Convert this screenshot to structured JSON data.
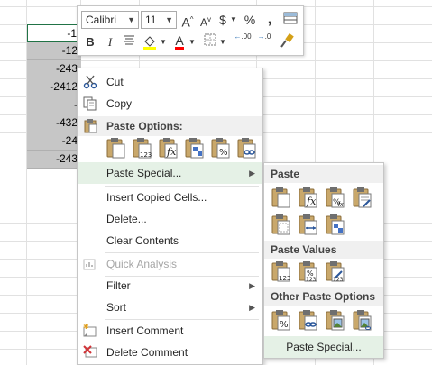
{
  "sheet": {
    "values": [
      "-1",
      "-12",
      "-243",
      "-2412",
      "-",
      "-432",
      "-24",
      "-243"
    ]
  },
  "mini_toolbar": {
    "font_name": "Calibri",
    "font_size": "11",
    "grow_font_label": "A",
    "shrink_font_label": "A",
    "currency_label": "$",
    "percent_label": "%",
    "bold_label": "B",
    "italic_label": "I",
    "font_color_label": "A",
    "increase_decimal_label": ".00",
    "decrease_decimal_label": ".0",
    "highlight_color": "#ffff00",
    "font_color": "#ff0000"
  },
  "context_menu": {
    "cut": "Cut",
    "copy": "Copy",
    "paste_options_header": "Paste Options:",
    "paste_special": "Paste Special...",
    "insert_copied_cells": "Insert Copied Cells...",
    "delete": "Delete...",
    "clear_contents": "Clear Contents",
    "quick_analysis": "Quick Analysis",
    "filter": "Filter",
    "sort": "Sort",
    "insert_comment": "Insert Comment",
    "delete_comment": "Delete Comment",
    "paste_icons": [
      "paste-icon",
      "values-123-icon",
      "formulas-fx-icon",
      "transpose-icon",
      "formatting-percent-icon",
      "paste-link-icon"
    ]
  },
  "submenu": {
    "paste_header": "Paste",
    "paste_values_header": "Paste Values",
    "other_header": "Other Paste Options",
    "footer": "Paste Special...",
    "value_label": "123"
  },
  "colors": {
    "hover_green": "#e5f1e6",
    "excel_green": "#217346",
    "clipboard_brown": "#8a6d3b"
  }
}
